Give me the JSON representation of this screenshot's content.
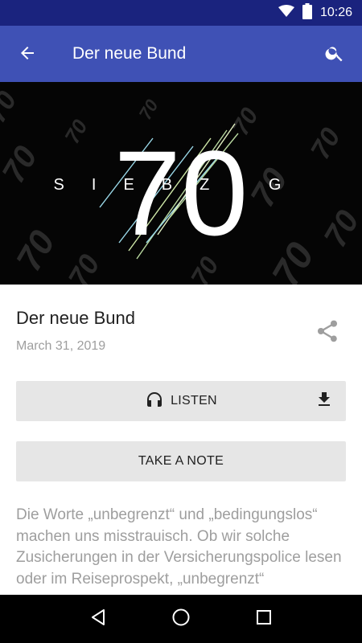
{
  "status_bar": {
    "time": "10:26",
    "icons": [
      "wifi-icon",
      "battery-icon"
    ]
  },
  "app_bar": {
    "title": "Der neue Bund",
    "back_icon": "arrow-left-icon",
    "search_icon": "search-icon",
    "background_color": "#3f51b5",
    "status_color": "#1a237e"
  },
  "cover": {
    "number": "70",
    "word": "SIEBZIG"
  },
  "episode": {
    "title": "Der neue Bund",
    "date": "March 31, 2019",
    "share_icon": "share-icon"
  },
  "actions": {
    "listen_label": "LISTEN",
    "listen_icon": "headphones-icon",
    "download_icon": "download-icon",
    "note_label": "TAKE A NOTE"
  },
  "description": "Die Worte „unbegrenzt“ und „bedingungslos“ machen uns misstrauisch. Ob wir solche Zusicherungen in der Versicherungspolice lesen oder im Reiseprospekt, „unbegrenzt“",
  "nav_bar": {
    "items": [
      "back-triangle-icon",
      "home-circle-icon",
      "recents-square-icon"
    ]
  }
}
